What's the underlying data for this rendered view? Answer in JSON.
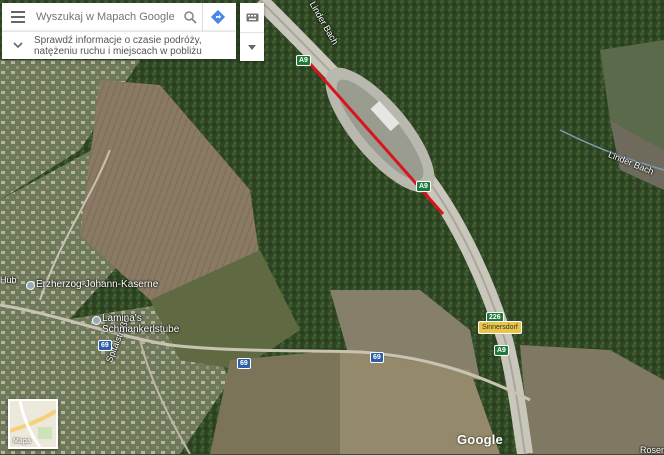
{
  "search": {
    "placeholder": "Wyszukaj w Mapach Google"
  },
  "traffic_panel": {
    "text": "Sprawdź informacje o czasie podróży, natężeniu ruchu i miejscach w pobliżu"
  },
  "map": {
    "places": [
      {
        "name": "Erzherzog-Johann-Kaserne"
      },
      {
        "name": "Lamina's"
      },
      {
        "name": "Schmankerlstube"
      },
      {
        "name": "Linder Bach"
      },
      {
        "name": "Sinnersdorf"
      },
      {
        "name": "Spitalstraße"
      },
      {
        "name": "Hub"
      },
      {
        "name": "Rosen"
      }
    ],
    "road_shields": [
      {
        "label": "A9",
        "style": "green"
      },
      {
        "label": "A9",
        "style": "green"
      },
      {
        "label": "69",
        "style": "blue"
      },
      {
        "label": "69",
        "style": "blue"
      },
      {
        "label": "226",
        "style": "green"
      },
      {
        "label": "A9",
        "style": "green"
      },
      {
        "label": "69",
        "style": "blue"
      },
      {
        "label": "Sinnersdorf",
        "style": "yellow"
      }
    ],
    "traffic_highlight_color": "#d9141f"
  },
  "layer_button": {
    "label": "Mapa"
  },
  "logo": {
    "text": "Google"
  },
  "icons": {
    "menu": "hamburger-menu-icon",
    "search": "search-icon",
    "directions": "directions-icon",
    "traffic_toggle": "chevron-down-icon",
    "keyboard": "keyboard-icon",
    "collapse": "caret-down-icon"
  }
}
